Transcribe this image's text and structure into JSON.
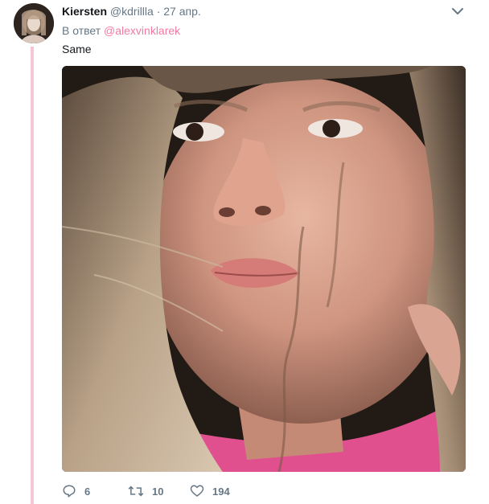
{
  "tweet": {
    "author_name": "Kiersten",
    "author_handle": "@kdrillla",
    "separator": "·",
    "time": "27 апр.",
    "reply_prefix": "В ответ",
    "reply_to": "@alexvinklarek",
    "text": "Same"
  },
  "actions": {
    "reply_icon": "comment-icon",
    "reply_count": "6",
    "retweet_icon": "retweet-icon",
    "retweet_count": "10",
    "like_icon": "heart-icon",
    "like_count": "194"
  },
  "colors": {
    "thread_line": "#f5c6d6",
    "mention": "#f27aa5",
    "secondary_text": "#657786"
  }
}
